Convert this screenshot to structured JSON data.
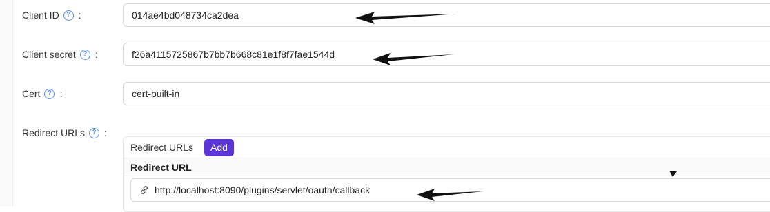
{
  "fields": {
    "client_id": {
      "label": "Client ID",
      "value": "014ae4bd048734ca2dea"
    },
    "client_secret": {
      "label": "Client secret",
      "value": "f26a4115725867b7bb7b668c81e1f8f7fae1544d"
    },
    "cert": {
      "label": "Cert",
      "value": "cert-built-in"
    },
    "redirect_urls": {
      "label": "Redirect URLs"
    }
  },
  "help_glyph": "?",
  "colon": ":",
  "redirect_table": {
    "header_label": "Redirect URLs",
    "add_label": "Add",
    "column_header": "Redirect URL",
    "url_value": "http://localhost:8090/plugins/servlet/oauth/callback"
  },
  "icons": {
    "help": "question-circle-icon",
    "link": "link-icon",
    "annotation": "arrow-left-icon"
  },
  "colors": {
    "accent": "#5b35d5",
    "help": "#5b8def",
    "border": "#d9d9d9"
  }
}
